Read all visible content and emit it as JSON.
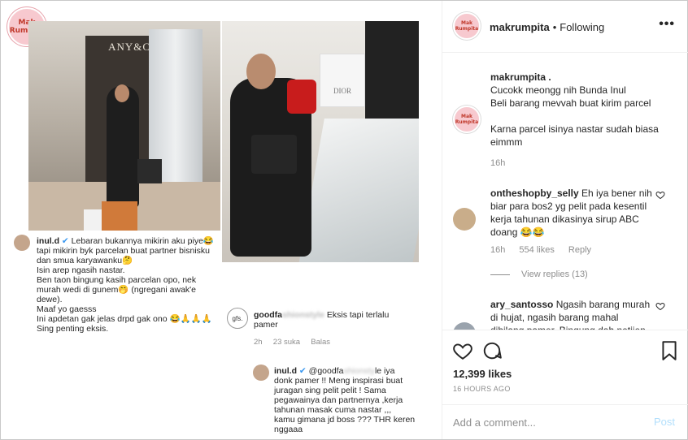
{
  "image": {
    "logo_text": "Mak Rumpita",
    "photo1_sign": "ANY&Co.",
    "photo2_bag_text": "DIOR",
    "comment1": {
      "username": "inul.d",
      "lines": [
        "Lebaran bukannya mikirin aku piye😂",
        "tapi mikirin byk parcelan buat partner bisnisku",
        "dan smua karyawanku🤔",
        "Isin arep ngasih nastar.",
        "Ben taon bingung kasih parcelan opo, nek",
        "murah wedi di gunem🤭 (ngregani awak'e",
        "dewe).",
        "Maaf yo gaesss",
        "Ini apdetan gak jelas drpd gak ono 😂🙏🙏🙏",
        "Sing penting eksis."
      ]
    },
    "comment2": {
      "avatar_text": "gfs.",
      "username": "goodfa",
      "username_blur": "shionstyle",
      "text": "Eksis tapi terlalu",
      "text2": "pamer",
      "time": "2h",
      "likes": "23 suka",
      "reply": "Balas"
    },
    "comment3": {
      "username": "inul.d",
      "mention": "@goodfa",
      "mention_blur": "shionsty",
      "lines": [
        "le iya",
        "donk pamer !! Meng inspirasi buat",
        "juragan sing pelit pelit !  Sama",
        "pegawainya dan partnernya ,kerja",
        "tahunan masak cuma nastar ,,,",
        "kamu gimana jd boss ??? THR keren",
        "nggaaa"
      ]
    }
  },
  "header": {
    "username": "makrumpita",
    "separator": "•",
    "follow_status": "Following",
    "more": "•••",
    "avatar_text": "Mak Rumpita"
  },
  "caption": {
    "username": "makrumpita .",
    "lines": [
      "Cucokk meongg nih Bunda Inul",
      "Beli barang mevvah buat kirim parcel",
      "",
      "Karna parcel isinya nastar sudah biasa",
      "eimmm"
    ],
    "time": "16h"
  },
  "comments": [
    {
      "username": "ontheshopby_selly",
      "text": "Eh iya bener nih biar para bos2 yg pelit pada kesentil kerja tahunan dikasinya sirup ABC doang 😂😂",
      "time": "16h",
      "likes": "554 likes",
      "reply": "Reply",
      "view_replies": "View replies (13)"
    },
    {
      "username": "ary_santosso",
      "text": "Ngasih barang murah di hujat, ngasih barang",
      "text_cut": "mahal dibilang pamer. Bingung dah netijen"
    }
  ],
  "actions": {
    "likes": "12,399 likes",
    "time_ago": "16 HOURS AGO"
  },
  "add_comment": {
    "placeholder": "Add a comment...",
    "post_label": "Post"
  }
}
